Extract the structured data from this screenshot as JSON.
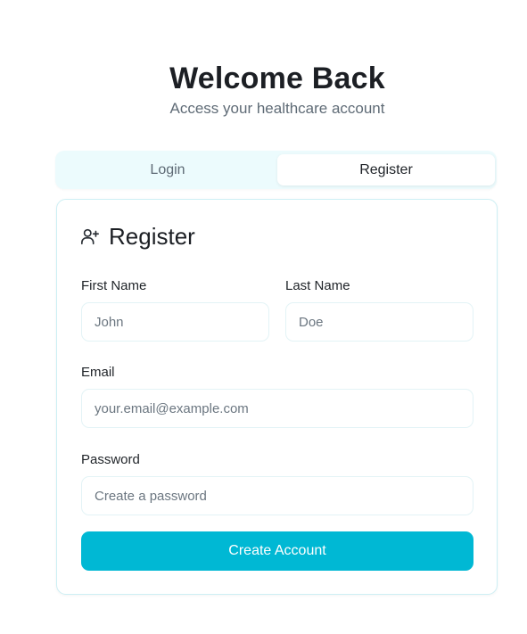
{
  "header": {
    "title": "Welcome Back",
    "subtitle": "Access your healthcare account"
  },
  "tabs": [
    {
      "label": "Login",
      "active": false
    },
    {
      "label": "Register",
      "active": true
    }
  ],
  "card": {
    "title": "Register",
    "icon": "user-plus-icon",
    "fields": {
      "first_name": {
        "label": "First Name",
        "placeholder": "John",
        "value": ""
      },
      "last_name": {
        "label": "Last Name",
        "placeholder": "Doe",
        "value": ""
      },
      "email": {
        "label": "Email",
        "placeholder": "your.email@example.com",
        "value": ""
      },
      "password": {
        "label": "Password",
        "placeholder": "Create a password",
        "value": ""
      }
    },
    "submit_label": "Create Account"
  },
  "colors": {
    "accent": "#00b8d4",
    "tab_bg": "#ecfbfd",
    "card_border": "#cdeff4"
  }
}
